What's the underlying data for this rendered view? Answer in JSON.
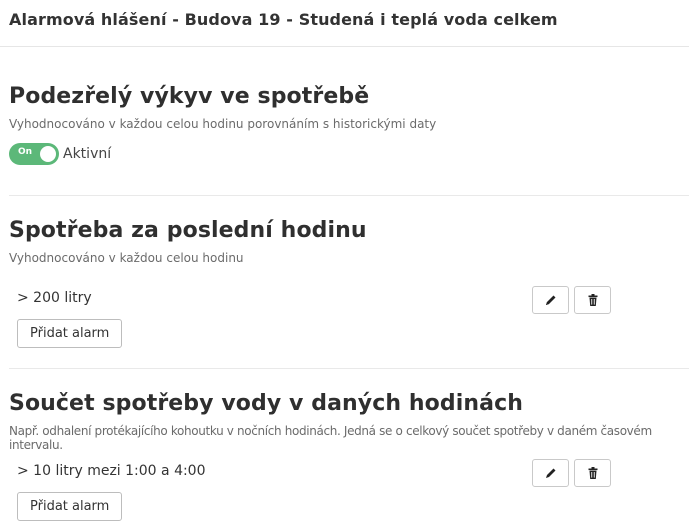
{
  "header": {
    "title": "Alarmová hlášení - Budova 19 - Studená i teplá voda celkem"
  },
  "sections": [
    {
      "title": "Podezřelý výkyv ve spotřebě",
      "description": "Vyhodnocováno v každou celou hodinu porovnáním s historickými daty",
      "toggle": {
        "state_label": "On",
        "label": "Aktivní",
        "enabled": true
      }
    },
    {
      "title": "Spotřeba za poslední hodinu",
      "description": "Vyhodnocováno v každou celou hodinu",
      "rules": [
        {
          "text": "> 200 litry"
        }
      ],
      "add_label": "Přidat alarm"
    },
    {
      "title": "Součet spotřeby vody v daných hodinách",
      "description": "Např. odhalení protékajícího kohoutku v nočních hodinách. Jedná se o celkový součet spotřeby v daném časovém intervalu.",
      "rules": [
        {
          "text": "> 10 litry mezi 1:00 a 4:00"
        }
      ],
      "add_label": "Přidat alarm"
    }
  ],
  "icons": {
    "edit": "pencil-icon",
    "delete": "trash-icon"
  },
  "colors": {
    "toggle_on": "#5cb879"
  }
}
